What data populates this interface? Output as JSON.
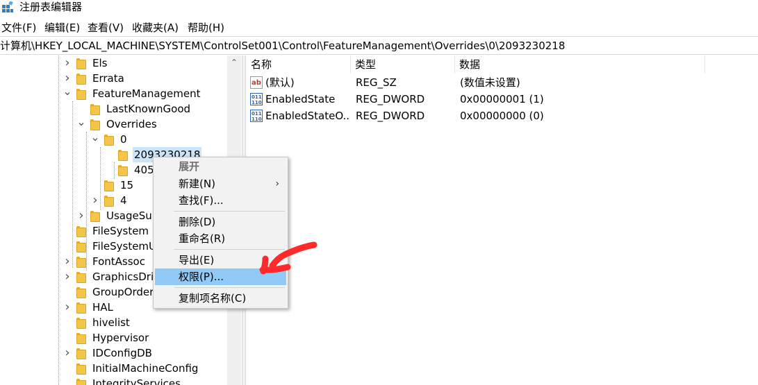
{
  "window": {
    "title": "注册表编辑器"
  },
  "menubar": {
    "items": [
      "文件(F)",
      "编辑(E)",
      "查看(V)",
      "收藏夹(A)",
      "帮助(H)"
    ]
  },
  "address": {
    "path": "计算机\\HKEY_LOCAL_MACHINE\\SYSTEM\\ControlSet001\\Control\\FeatureManagement\\Overrides\\0\\2093230218"
  },
  "tree": {
    "items": [
      {
        "label": "Els",
        "expander": "collapsed"
      },
      {
        "label": "Errata",
        "expander": "collapsed"
      },
      {
        "label": "FeatureManagement",
        "expander": "expanded"
      },
      {
        "label": "LastKnownGood",
        "expander": "none"
      },
      {
        "label": "Overrides",
        "expander": "expanded"
      },
      {
        "label": "0",
        "expander": "expanded"
      },
      {
        "label": "2093230218",
        "expander": "none",
        "selected": true
      },
      {
        "label": "405",
        "expander": "none"
      },
      {
        "label": "15",
        "expander": "none"
      },
      {
        "label": "4",
        "expander": "collapsed"
      },
      {
        "label": "UsageSub",
        "expander": "collapsed"
      },
      {
        "label": "FileSystem",
        "expander": "none"
      },
      {
        "label": "FileSystemU",
        "expander": "none"
      },
      {
        "label": "FontAssoc",
        "expander": "collapsed"
      },
      {
        "label": "GraphicsDriv",
        "expander": "collapsed"
      },
      {
        "label": "GroupOrder",
        "expander": "none"
      },
      {
        "label": "HAL",
        "expander": "collapsed"
      },
      {
        "label": "hivelist",
        "expander": "none"
      },
      {
        "label": "Hypervisor",
        "expander": "none"
      },
      {
        "label": "IDConfigDB",
        "expander": "collapsed"
      },
      {
        "label": "InitialMachineConfig",
        "expander": "none"
      },
      {
        "label": "IntegrityServices",
        "expander": "none"
      }
    ]
  },
  "list": {
    "columns": [
      "名称",
      "类型",
      "数据"
    ],
    "rows": [
      {
        "icon": "string-value-icon",
        "name": "(默认)",
        "type": "REG_SZ",
        "data": "(数值未设置)"
      },
      {
        "icon": "binary-value-icon",
        "name": "EnabledState",
        "type": "REG_DWORD",
        "data": "0x00000001 (1)"
      },
      {
        "icon": "binary-value-icon",
        "name": "EnabledStateO...",
        "type": "REG_DWORD",
        "data": "0x00000000 (0)"
      }
    ]
  },
  "context_menu": {
    "expand": "展开",
    "new": "新建(N)",
    "find": "查找(F)...",
    "delete": "删除(D)",
    "rename": "重命名(R)",
    "export": "导出(E)",
    "permissions": "权限(P)...",
    "copy_key_name": "复制项名称(C)"
  },
  "colors": {
    "selection": "#cce4f7",
    "menu_highlight": "#91c9f7",
    "annotation": "#ff2a2a"
  }
}
